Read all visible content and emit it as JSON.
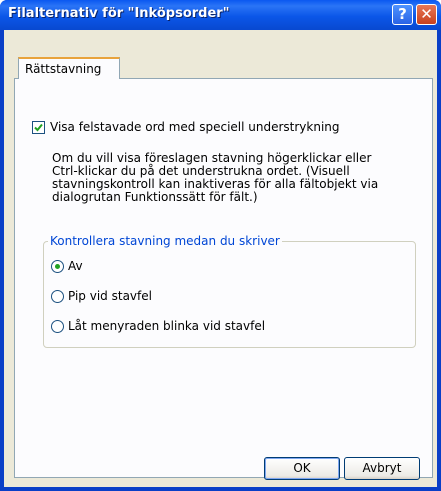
{
  "window": {
    "title": "Filalternativ för \"Inköpsorder\"",
    "help_glyph": "?",
    "close_glyph": "✕"
  },
  "tabs": [
    {
      "label": "Rättstavning",
      "selected": true
    }
  ],
  "spelling": {
    "checkbox_label": "Visa felstavade ord med speciell understrykning",
    "checkbox_checked": true,
    "description_lines": [
      "Om du vill visa föreslagen stavning högerklickar eller",
      "Ctrl-klickar du på det understrukna ordet. (Visuell",
      "stavningskontroll kan inaktiveras för alla fältobjekt via",
      "dialogrutan Funktionssätt för fält.)"
    ],
    "group_title": "Kontrollera stavning medan du skriver",
    "options": [
      {
        "label": "Av",
        "selected": true
      },
      {
        "label": "Pip vid stavfel",
        "selected": false
      },
      {
        "label": "Låt menyraden blinka vid stavfel",
        "selected": false
      }
    ]
  },
  "buttons": {
    "ok": "OK",
    "cancel": "Avbryt"
  },
  "colors": {
    "titlebar": "#0a58f0",
    "group_title": "#0046d5",
    "radio_dot": "#21a121",
    "check_mark": "#21a121"
  }
}
